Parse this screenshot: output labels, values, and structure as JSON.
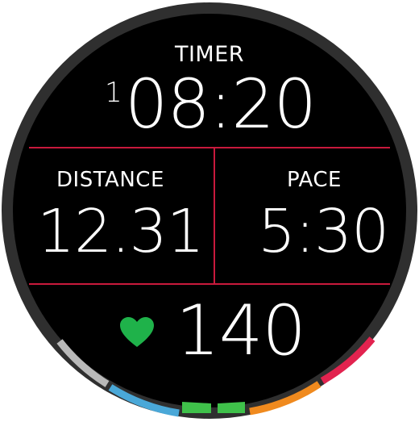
{
  "timer": {
    "label": "TIMER",
    "lap": "1",
    "value": "08:20"
  },
  "distance": {
    "label": "DISTANCE",
    "value": "12.31"
  },
  "pace": {
    "label": "PACE",
    "value": "5:30"
  },
  "heart_rate": {
    "value": "140",
    "icon": "heart-icon"
  },
  "colors": {
    "divider": "#c8193c",
    "heart": "#1fb24a",
    "zone1": "#b9b9b9",
    "zone2": "#4aa8d8",
    "zone3": "#3fc14a",
    "zone4": "#f08a1e",
    "zone5": "#e2234f"
  },
  "hr_zone_gauge": {
    "zones": [
      "zone1",
      "zone2",
      "zone3",
      "zone4",
      "zone5"
    ],
    "active_zone": "zone3"
  }
}
